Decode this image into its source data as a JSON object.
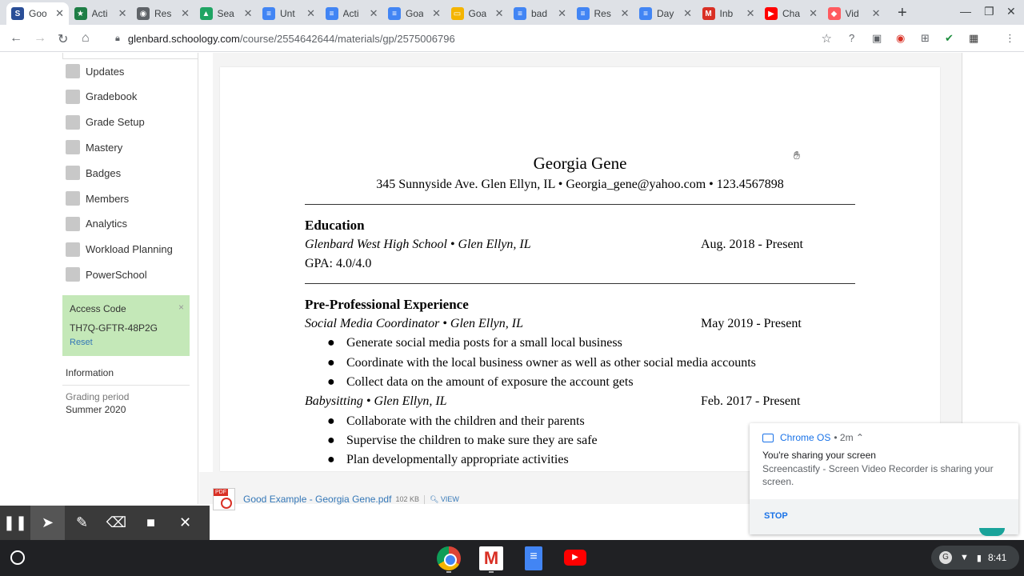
{
  "browser": {
    "tabs": [
      {
        "title": "Goo",
        "favicon": "S",
        "color": "#2a4e97",
        "active": true
      },
      {
        "title": "Acti",
        "favicon": "★",
        "color": "#1e7e46"
      },
      {
        "title": "Res",
        "favicon": "◉",
        "color": "#5f6368"
      },
      {
        "title": "Sea",
        "favicon": "▲",
        "color": "#1fa463"
      },
      {
        "title": "Unt",
        "favicon": "≡",
        "color": "#4285f4"
      },
      {
        "title": "Acti",
        "favicon": "≡",
        "color": "#4285f4"
      },
      {
        "title": "Goa",
        "favicon": "≡",
        "color": "#4285f4"
      },
      {
        "title": "Goa",
        "favicon": "▭",
        "color": "#f4b400"
      },
      {
        "title": "bad",
        "favicon": "≡",
        "color": "#4285f4"
      },
      {
        "title": "Res",
        "favicon": "≡",
        "color": "#4285f4"
      },
      {
        "title": "Day",
        "favicon": "≡",
        "color": "#4285f4"
      },
      {
        "title": "Inb",
        "favicon": "M",
        "color": "#d93025"
      },
      {
        "title": "Cha",
        "favicon": "▶",
        "color": "#ff0000"
      },
      {
        "title": "Vid",
        "favicon": "◆",
        "color": "#ff5a5f"
      }
    ],
    "url_domain": "glenbard.schoology.com",
    "url_path": "/course/2554642644/materials/gp/2575006796"
  },
  "sidebar": {
    "items": [
      {
        "label": "Updates"
      },
      {
        "label": "Gradebook"
      },
      {
        "label": "Grade Setup"
      },
      {
        "label": "Mastery"
      },
      {
        "label": "Badges"
      },
      {
        "label": "Members"
      },
      {
        "label": "Analytics"
      },
      {
        "label": "Workload Planning"
      },
      {
        "label": "PowerSchool"
      }
    ],
    "access": {
      "heading": "Access Code",
      "code": "TH7Q-GFTR-48P2G",
      "reset": "Reset",
      "close": "×"
    },
    "info": {
      "heading": "Information",
      "label": "Grading period",
      "value": "Summer 2020"
    }
  },
  "resume": {
    "name": "Georgia Gene",
    "contact": "345 Sunnyside Ave. Glen Ellyn, IL • Georgia_gene@yahoo.com • 123.4567898",
    "education": {
      "heading": "Education",
      "school": "Glenbard West High School • Glen Ellyn, IL",
      "date": "Aug. 2018 - Present",
      "gpa": "GPA: 4.0/4.0"
    },
    "experience": {
      "heading": "Pre-Professional Experience",
      "jobs": [
        {
          "title": "Social Media Coordinator • Glen Ellyn, IL",
          "date": "May 2019 - Present",
          "bullets": [
            "Generate social media posts for a small local business",
            "Coordinate with the local business owner as well as other social media accounts",
            "Collect data on the amount of exposure the account gets"
          ]
        },
        {
          "title": "Babysitting • Glen Ellyn, IL",
          "date": "Feb. 2017 - Present",
          "bullets": [
            "Collaborate with the children and their parents",
            "Supervise the children to make sure they are safe",
            "Plan developmentally appropriate activities"
          ]
        }
      ]
    }
  },
  "attachment": {
    "filename": "Good Example - Georgia Gene.pdf",
    "size": "102 KB",
    "view": "VIEW"
  },
  "notification": {
    "source": "Chrome OS",
    "time": "• 2m ⌃",
    "title": "You're sharing your screen",
    "body": "Screencastify - Screen Video Recorder is sharing your screen.",
    "stop": "STOP"
  },
  "tray": {
    "avatar": "G",
    "time": "8:41"
  }
}
